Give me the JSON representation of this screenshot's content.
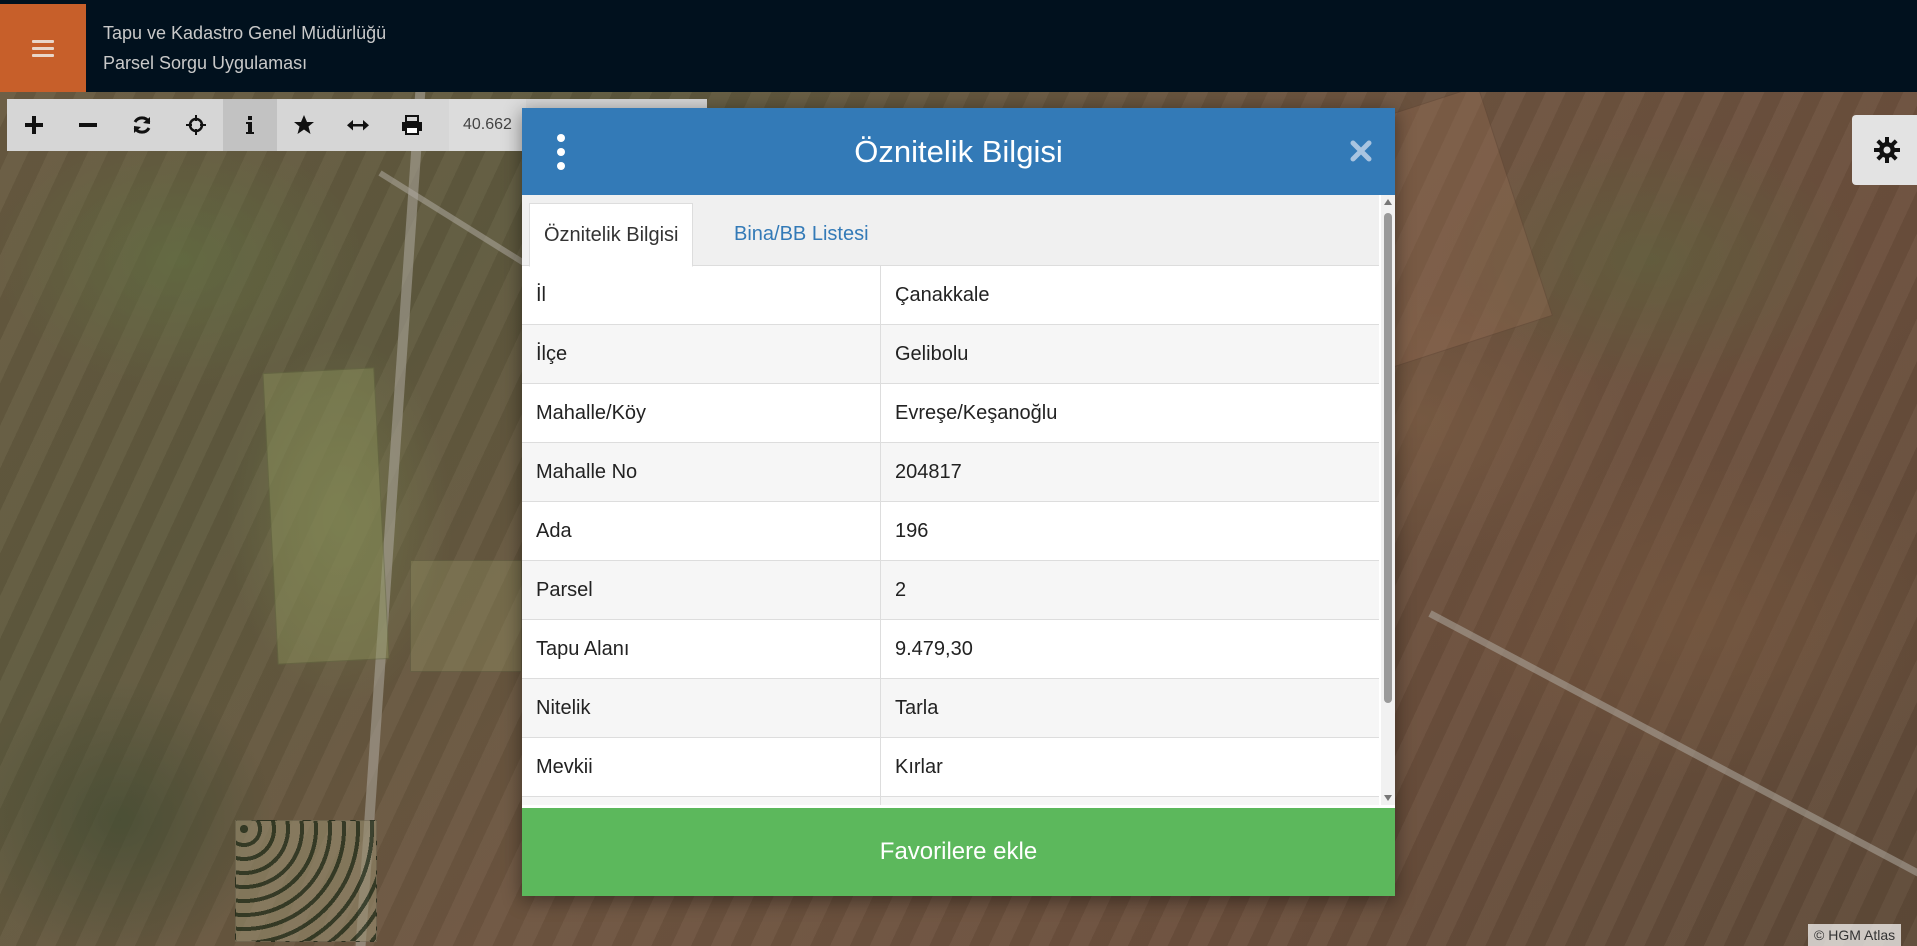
{
  "app": {
    "title_line1": "Tapu ve Kadastro Genel Müdürlüğü",
    "title_line2": "Parsel Sorgu Uygulaması"
  },
  "toolbar": {
    "coordinate": "40.662",
    "tools": [
      "zoom-in-icon",
      "zoom-out-icon",
      "refresh-icon",
      "locate-icon",
      "info-icon",
      "star-icon",
      "measure-icon",
      "print-icon"
    ]
  },
  "modal": {
    "title": "Öznitelik Bilgisi",
    "tabs": [
      {
        "label": "Öznitelik Bilgisi",
        "active": true
      },
      {
        "label": "Bina/BB Listesi",
        "active": false
      }
    ],
    "rows": [
      {
        "key": "İl",
        "value": "Çanakkale"
      },
      {
        "key": "İlçe",
        "value": "Gelibolu"
      },
      {
        "key": "Mahalle/Köy",
        "value": "Evreşe/Keşanoğlu"
      },
      {
        "key": "Mahalle No",
        "value": "204817"
      },
      {
        "key": "Ada",
        "value": "196"
      },
      {
        "key": "Parsel",
        "value": "2"
      },
      {
        "key": "Tapu Alanı",
        "value": "9.479,30"
      },
      {
        "key": "Nitelik",
        "value": "Tarla"
      },
      {
        "key": "Mevkii",
        "value": "Kırlar"
      }
    ],
    "footer_button": "Favorilere ekle"
  },
  "attribution": "© HGM Atlas",
  "colors": {
    "header_bg": "#01111e",
    "menu_btn": "#c75f2a",
    "modal_header": "#337ab7",
    "footer_btn": "#5cb85c"
  }
}
